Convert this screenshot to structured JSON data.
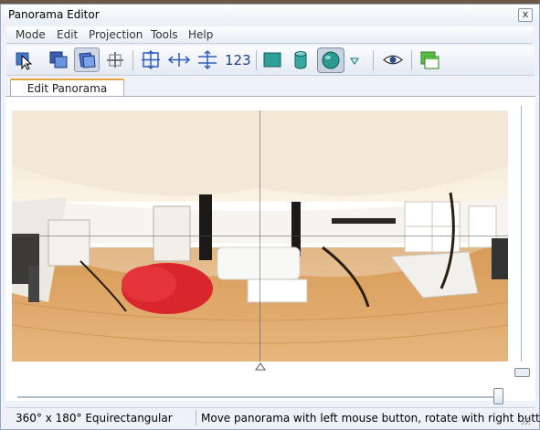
{
  "window": {
    "title": "Panorama Editor",
    "close_label": "x"
  },
  "menubar": {
    "items": [
      "Mode",
      "Edit",
      "Projection",
      "Tools",
      "Help"
    ]
  },
  "toolbar": {
    "buttons": [
      {
        "icon": "select-arrow-icon"
      },
      {
        "icon": "overlap-images-icon"
      },
      {
        "icon": "drag-image-icon",
        "active": true
      },
      {
        "icon": "crosshair-icon"
      },
      {
        "icon": "center-panorama-icon"
      },
      {
        "icon": "fit-horizontal-icon"
      },
      {
        "icon": "fit-vertical-icon"
      },
      {
        "icon": "number-images-icon",
        "label": "123"
      },
      {
        "icon": "rectilinear-projection-icon"
      },
      {
        "icon": "cylindrical-projection-icon"
      },
      {
        "icon": "spherical-projection-icon",
        "active": true
      },
      {
        "icon": "more-projections-icon"
      },
      {
        "icon": "preview-eye-icon"
      },
      {
        "icon": "layers-icon"
      }
    ]
  },
  "tabs": [
    {
      "label": "Edit Panorama",
      "active": true
    }
  ],
  "status": {
    "projection": "360° x 180° Equirectangular",
    "message": "Move panorama with left mouse button, rotate with right button"
  },
  "sliders": {
    "vertical_fraction": 1.0,
    "horizontal_fraction": 1.0
  },
  "colors": {
    "accent_tab": "#e8a33a",
    "chrome": "#eef1f7"
  }
}
